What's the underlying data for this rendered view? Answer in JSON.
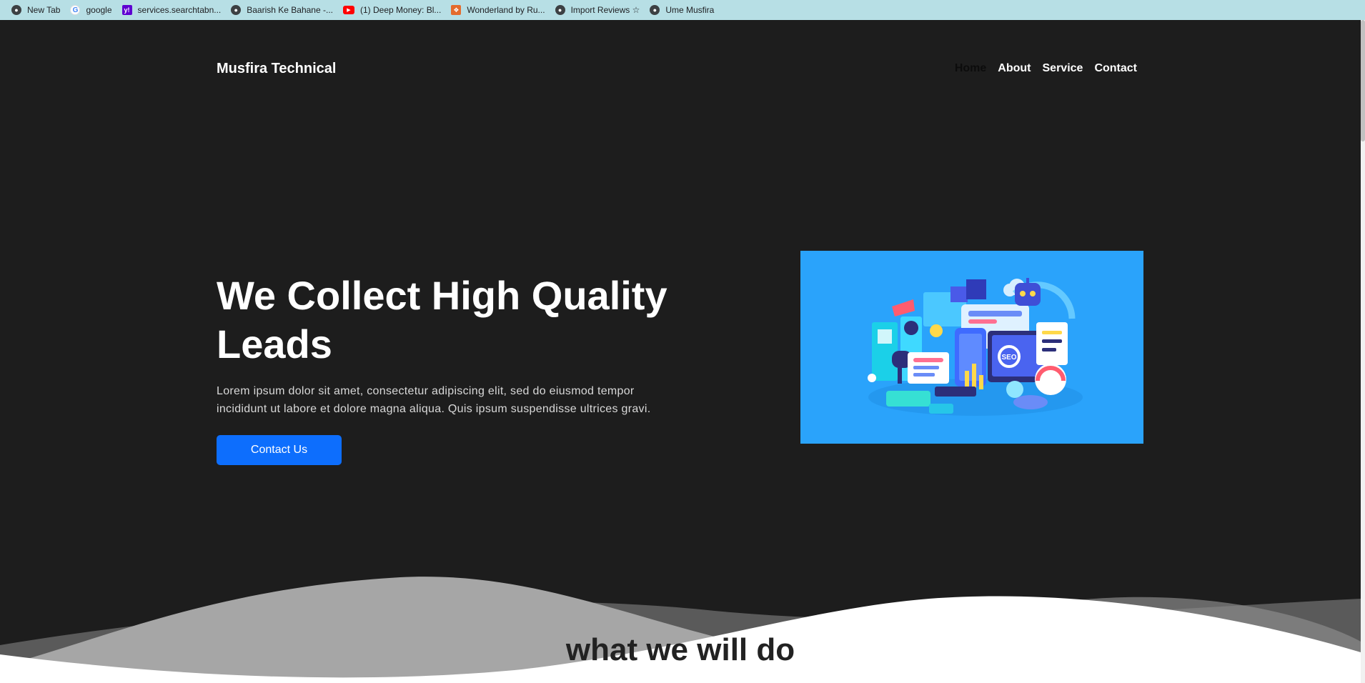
{
  "bookmarks": [
    {
      "label": "New Tab",
      "icon": "globe-icon"
    },
    {
      "label": "google",
      "icon": "google-icon"
    },
    {
      "label": "services.searchtabn...",
      "icon": "yahoo-icon"
    },
    {
      "label": "Baarish Ke Bahane -...",
      "icon": "globe-icon"
    },
    {
      "label": "(1) Deep Money: Bl...",
      "icon": "youtube-icon"
    },
    {
      "label": "Wonderland by Ru...",
      "icon": "wonderland-icon"
    },
    {
      "label": "Import Reviews ☆",
      "icon": "globe-icon"
    },
    {
      "label": "Ume Musfira",
      "icon": "globe-icon"
    }
  ],
  "header": {
    "brand": "Musfira Technical",
    "nav": [
      "Home",
      "About",
      "Service",
      "Contact"
    ]
  },
  "hero": {
    "headline": "We Collect High Quality Leads",
    "lead": "Lorem ipsum dolor sit amet, consectetur adipiscing elit, sed do eiusmod tempor incididunt ut labore et dolore magna aliqua. Quis ipsum suspendisse ultrices gravi.",
    "cta_label": "Contact Us",
    "illustration_badge": "SEO"
  },
  "section": {
    "title": "what we will do"
  },
  "colors": {
    "hero_background": "#1d1d1d",
    "accent": "#0d6efd",
    "illustration_background": "#2aa3fb",
    "bookmarks_bar": "#b7dfe5"
  }
}
